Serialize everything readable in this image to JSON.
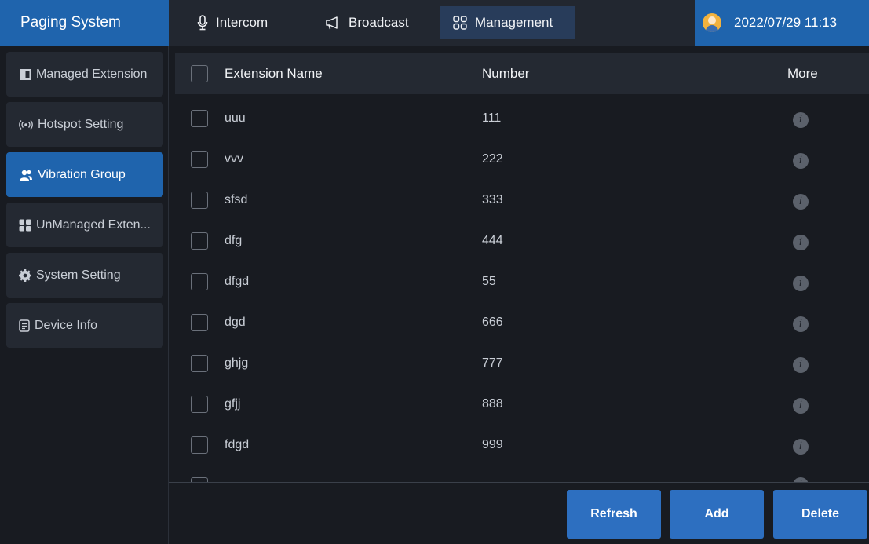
{
  "app": {
    "title": "Paging System"
  },
  "tabs": [
    {
      "label": "Intercom",
      "icon": "microphone-icon"
    },
    {
      "label": "Broadcast",
      "icon": "megaphone-icon"
    },
    {
      "label": "Management",
      "icon": "grid-icon",
      "active": true
    }
  ],
  "datetime": "2022/07/29 11:13",
  "sidebar": {
    "items": [
      {
        "label": "Managed Extension",
        "icon": "book-icon"
      },
      {
        "label": "Hotspot Setting",
        "icon": "hotspot-icon"
      },
      {
        "label": "Vibration Group",
        "icon": "group-icon",
        "active": true
      },
      {
        "label": "UnManaged Exten...",
        "icon": "grid-icon"
      },
      {
        "label": "System Setting",
        "icon": "gear-icon"
      },
      {
        "label": "Device Info",
        "icon": "document-icon"
      }
    ]
  },
  "table": {
    "headers": {
      "name": "Extension Name",
      "number": "Number",
      "more": "More"
    },
    "rows": [
      {
        "name": "uuu",
        "number": "111"
      },
      {
        "name": "vvv",
        "number": "222"
      },
      {
        "name": "sfsd",
        "number": "333"
      },
      {
        "name": "dfg",
        "number": "444"
      },
      {
        "name": "dfgd",
        "number": "55"
      },
      {
        "name": "dgd",
        "number": "666"
      },
      {
        "name": "ghjg",
        "number": "777"
      },
      {
        "name": "gfjj",
        "number": "888"
      },
      {
        "name": "fdgd",
        "number": "999"
      }
    ]
  },
  "buttons": {
    "refresh": "Refresh",
    "add": "Add",
    "delete": "Delete"
  },
  "colors": {
    "accent": "#1f64ad",
    "button": "#2d6fc0",
    "background": "#181b21",
    "panel": "#242932"
  }
}
